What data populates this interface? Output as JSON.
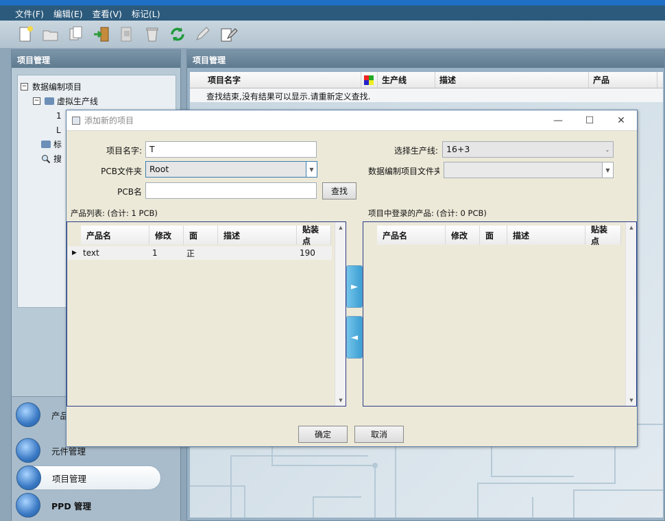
{
  "menu": {
    "items": [
      "文件(F)",
      "编辑(E)",
      "查看(V)",
      "标记(L)"
    ]
  },
  "toolbar": {
    "icons": [
      "new-icon",
      "open-folder-icon",
      "copy-icon",
      "import-icon",
      "export-icon",
      "delete-icon",
      "refresh-icon",
      "edit-icon",
      "properties-icon"
    ]
  },
  "left_panel": {
    "title": "项目管理",
    "tree": {
      "root": "数据编制项目",
      "child": "虚拟生产线",
      "child_items_partial": [
        "1",
        "L"
      ],
      "folder2_partial": "标",
      "search_partial": "搜"
    },
    "nav": [
      {
        "label": "产品",
        "active": false
      },
      {
        "label": "元件管理",
        "active": false
      },
      {
        "label": "项目管理",
        "active": true
      },
      {
        "label": "PPD 管理",
        "active": false
      }
    ]
  },
  "right_panel": {
    "title": "项目管理",
    "columns": [
      "项目名字",
      "生产线",
      "描述",
      "产品"
    ],
    "message": "查找结束,没有结果可以显示.请重新定义查找."
  },
  "dialog": {
    "title": "添加新的项目",
    "fields": {
      "project_name_label": "项目名字:",
      "project_name_value": "T",
      "pcb_folder_label": "PCB文件夹",
      "pcb_folder_value": "Root",
      "pcb_name_label": "PCB名",
      "pcb_name_value": "",
      "find_button": "查找",
      "line_label": "选择生产线:",
      "line_value": "16+3",
      "data_file_label": "数据编制项目文件夹",
      "data_file_value": ""
    },
    "left_list": {
      "caption": "产品列表: (合计: 1 PCB)",
      "columns": [
        "产品名",
        "修改",
        "面",
        "描述",
        "贴装点"
      ],
      "rows": [
        {
          "name": "text",
          "rev": "1",
          "side": "正",
          "desc": "",
          "points": "190"
        }
      ]
    },
    "right_list": {
      "caption": "项目中登录的产品: (合计: 0 PCB)",
      "columns": [
        "产品名",
        "修改",
        "面",
        "描述",
        "贴装点"
      ]
    },
    "buttons": {
      "ok": "确定",
      "cancel": "取消"
    }
  }
}
